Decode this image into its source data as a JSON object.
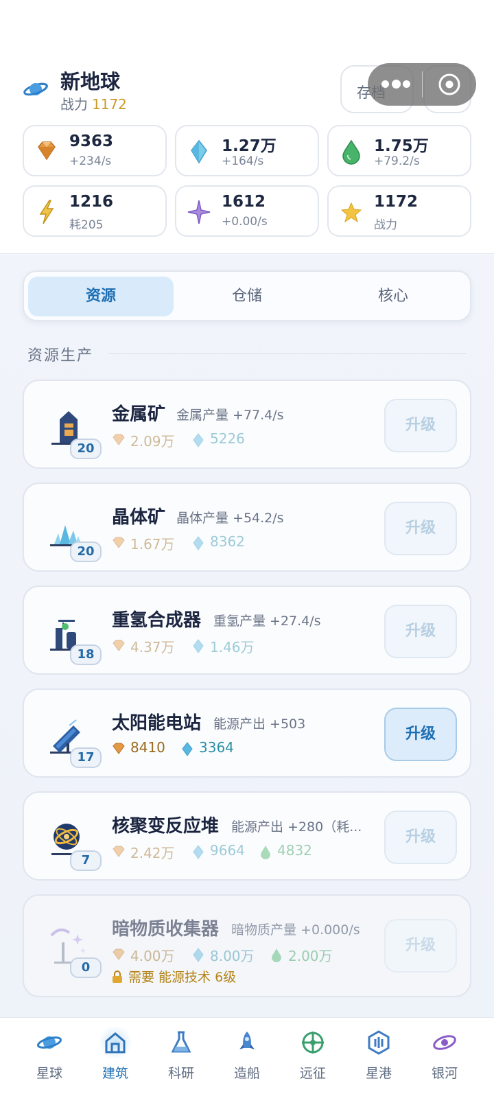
{
  "header": {
    "title": "新地球",
    "power_label": "战力",
    "power_value": "1172",
    "save_label": "存档"
  },
  "resources": [
    {
      "icon": "gem-icon",
      "value": "9363",
      "sub": "+234/s"
    },
    {
      "icon": "crystal-icon",
      "value": "1.27万",
      "sub": "+164/s"
    },
    {
      "icon": "droplet-icon",
      "value": "1.75万",
      "sub": "+79.2/s"
    },
    {
      "icon": "lightning-icon",
      "value": "1216",
      "sub": "耗205"
    },
    {
      "icon": "sparkle-icon",
      "value": "1612",
      "sub": "+0.00/s"
    },
    {
      "icon": "star-icon",
      "value": "1172",
      "sub": "战力"
    }
  ],
  "tabs": [
    {
      "label": "资源",
      "active": true
    },
    {
      "label": "仓储",
      "active": false
    },
    {
      "label": "核心",
      "active": false
    }
  ],
  "section_title": "资源生产",
  "buildings": [
    {
      "name": "金属矿",
      "level": "20",
      "desc": "金属产量 +77.4/s",
      "costs": [
        "2.09万",
        "5226"
      ],
      "upgrade": "升级",
      "affordable": false
    },
    {
      "name": "晶体矿",
      "level": "20",
      "desc": "晶体产量 +54.2/s",
      "costs": [
        "1.67万",
        "8362"
      ],
      "upgrade": "升级",
      "affordable": false
    },
    {
      "name": "重氢合成器",
      "level": "18",
      "desc": "重氢产量 +27.4/s",
      "costs": [
        "4.37万",
        "1.46万"
      ],
      "upgrade": "升级",
      "affordable": false
    },
    {
      "name": "太阳能电站",
      "level": "17",
      "desc": "能源产出 +503",
      "costs": [
        "8410",
        "3364"
      ],
      "upgrade": "升级",
      "affordable": true
    },
    {
      "name": "核聚变反应堆",
      "level": "7",
      "desc": "能源产出 +280（耗...",
      "costs": [
        "2.42万",
        "9664",
        "4832"
      ],
      "upgrade": "升级",
      "affordable": false
    },
    {
      "name": "暗物质收集器",
      "level": "0",
      "desc": "暗物质产量 +0.000/s",
      "costs": [
        "4.00万",
        "8.00万",
        "2.00万"
      ],
      "upgrade": "升级",
      "affordable": false,
      "locked": true,
      "requirement": "需要 能源技术 6级"
    }
  ],
  "nav": [
    {
      "label": "星球",
      "icon": "planet-icon",
      "active": false
    },
    {
      "label": "建筑",
      "icon": "building-icon",
      "active": true
    },
    {
      "label": "科研",
      "icon": "flask-icon",
      "active": false
    },
    {
      "label": "造船",
      "icon": "rocket-icon",
      "active": false
    },
    {
      "label": "远征",
      "icon": "crosshair-icon",
      "active": false
    },
    {
      "label": "星港",
      "icon": "shield-port-icon",
      "active": false
    },
    {
      "label": "银河",
      "icon": "galaxy-icon",
      "active": false
    }
  ],
  "colors": {
    "accent": "#1e6fb3",
    "gold": "#c99a26",
    "gem": "#e0913a",
    "crystal": "#4fb3d9",
    "deuterium": "#3fae5b"
  }
}
